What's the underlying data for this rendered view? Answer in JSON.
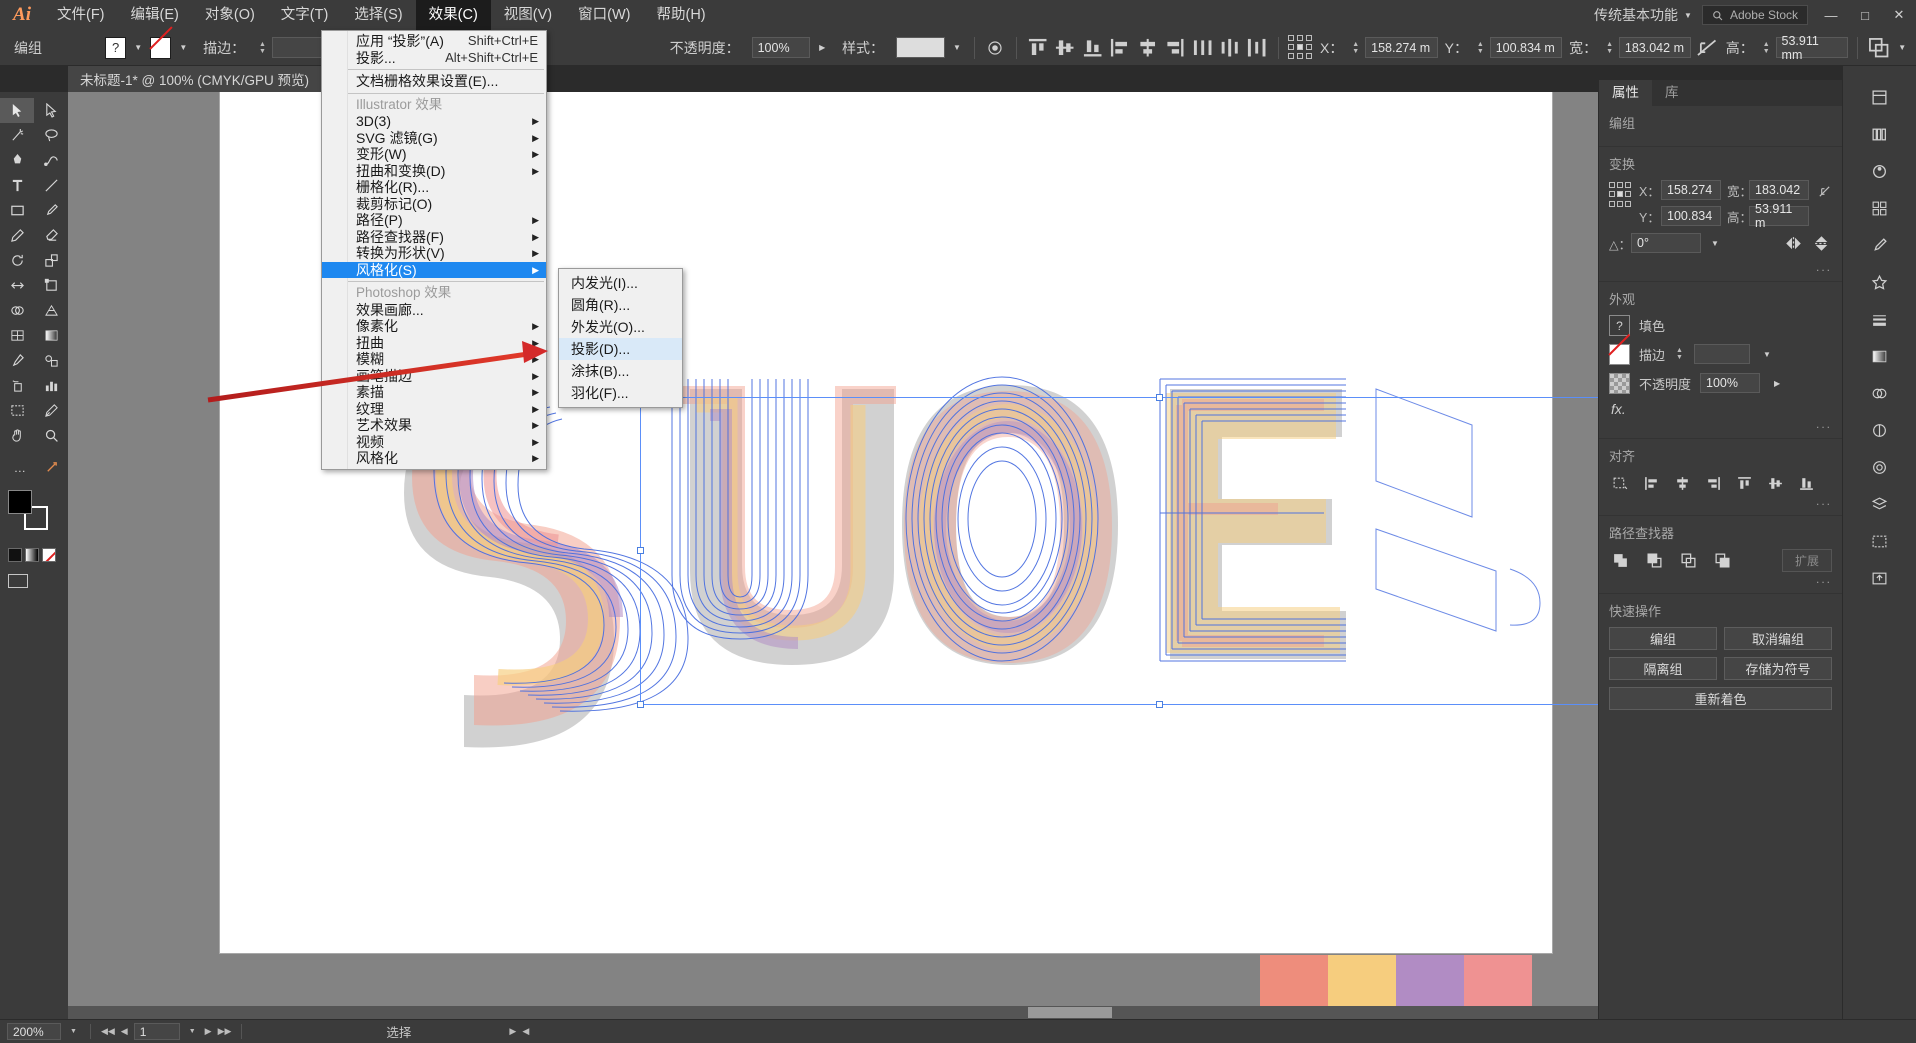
{
  "app": {
    "name": "Ai",
    "workspace": "传统基本功能",
    "stock_label": "Adobe Stock"
  },
  "menubar": {
    "items": [
      {
        "label": "文件(F)"
      },
      {
        "label": "编辑(E)"
      },
      {
        "label": "对象(O)"
      },
      {
        "label": "文字(T)"
      },
      {
        "label": "选择(S)"
      },
      {
        "label": "效果(C)"
      },
      {
        "label": "视图(V)"
      },
      {
        "label": "窗口(W)"
      },
      {
        "label": "帮助(H)"
      }
    ],
    "active_index": 5,
    "window_buttons": [
      "—",
      "□",
      "✕"
    ]
  },
  "controlbar": {
    "selection_label": "编组",
    "fill_label": "?",
    "stroke_label": "描边：",
    "stroke_weight": "",
    "opacity_label": "不透明度：",
    "opacity_value": "100%",
    "style_label": "样式：",
    "x_label": "X：",
    "x_value": "158.274 m",
    "y_label": "Y：",
    "y_value": "100.834 m",
    "w_label": "宽：",
    "w_value": "183.042 m",
    "h_label": "高：",
    "h_value": "53.911 mm"
  },
  "tabbar": {
    "doc_title": "未标题-1* @ 100% (CMYK/GPU 预览)",
    "close": "✕"
  },
  "dropdown": {
    "groups": [
      {
        "items": [
          {
            "label": "应用 “投影”(A)",
            "shortcut": "Shift+Ctrl+E",
            "arrow": false,
            "disabled": false
          },
          {
            "label": "投影...",
            "shortcut": "Alt+Shift+Ctrl+E",
            "arrow": false,
            "disabled": false
          }
        ]
      },
      {
        "items": [
          {
            "label": "文档栅格效果设置(E)...",
            "shortcut": "",
            "arrow": false,
            "disabled": false
          }
        ]
      },
      {
        "header": "Illustrator 效果",
        "items": [
          {
            "label": "3D(3)",
            "shortcut": "",
            "arrow": true
          },
          {
            "label": "SVG 滤镜(G)",
            "shortcut": "",
            "arrow": true
          },
          {
            "label": "变形(W)",
            "shortcut": "",
            "arrow": true
          },
          {
            "label": "扭曲和变换(D)",
            "shortcut": "",
            "arrow": true
          },
          {
            "label": "栅格化(R)...",
            "shortcut": "",
            "arrow": false
          },
          {
            "label": "裁剪标记(O)",
            "shortcut": "",
            "arrow": false
          },
          {
            "label": "路径(P)",
            "shortcut": "",
            "arrow": true
          },
          {
            "label": "路径查找器(F)",
            "shortcut": "",
            "arrow": true
          },
          {
            "label": "转换为形状(V)",
            "shortcut": "",
            "arrow": true
          },
          {
            "label": "风格化(S)",
            "shortcut": "",
            "arrow": true,
            "highlight": true
          }
        ]
      },
      {
        "header": "Photoshop 效果",
        "items": [
          {
            "label": "效果画廊...",
            "shortcut": "",
            "arrow": false
          },
          {
            "label": "像素化",
            "shortcut": "",
            "arrow": true
          },
          {
            "label": "扭曲",
            "shortcut": "",
            "arrow": true
          },
          {
            "label": "模糊",
            "shortcut": "",
            "arrow": true
          },
          {
            "label": "画笔描边",
            "shortcut": "",
            "arrow": true
          },
          {
            "label": "素描",
            "shortcut": "",
            "arrow": true
          },
          {
            "label": "纹理",
            "shortcut": "",
            "arrow": true
          },
          {
            "label": "艺术效果",
            "shortcut": "",
            "arrow": true
          },
          {
            "label": "视频",
            "shortcut": "",
            "arrow": true
          },
          {
            "label": "风格化",
            "shortcut": "",
            "arrow": true
          }
        ]
      }
    ]
  },
  "submenu": {
    "items": [
      {
        "label": "内发光(I)...",
        "highlight": false
      },
      {
        "label": "圆角(R)...",
        "highlight": false
      },
      {
        "label": "外发光(O)...",
        "highlight": false
      },
      {
        "label": "投影(D)...",
        "highlight": true
      },
      {
        "label": "涂抹(B)...",
        "highlight": false
      },
      {
        "label": "羽化(F)...",
        "highlight": false
      }
    ]
  },
  "properties": {
    "tabs": [
      {
        "label": "属性",
        "active": true
      },
      {
        "label": "库",
        "active": false
      }
    ],
    "object_label": "编组",
    "transform": {
      "title": "变换",
      "x_label": "X：",
      "x_value": "158.274",
      "y_label": "Y：",
      "y_value": "100.834",
      "w_label": "宽：",
      "w_value": "183.042",
      "h_label": "高：",
      "h_value": "53.911 m",
      "angle_label": "△：",
      "angle_value": "0°",
      "more": "..."
    },
    "appearance": {
      "title": "外观",
      "fill_label": "填色",
      "fill_swatch_text": "?",
      "stroke_label": "描边",
      "opacity_label": "不透明度",
      "opacity_value": "100%",
      "fx_label": "fx.",
      "more": "..."
    },
    "align": {
      "title": "对齐",
      "more": "..."
    },
    "pathfinder": {
      "title": "路径查找器",
      "more": "...",
      "expand_label": "扩展"
    },
    "quick": {
      "title": "快速操作",
      "buttons": [
        "编组",
        "取消编组",
        "隔离组",
        "存储为符号",
        "重新着色"
      ]
    }
  },
  "statusbar": {
    "zoom": "200%",
    "page": "1",
    "tool_label": "选择"
  },
  "artwork": {
    "text": "SUOE",
    "palette_colors": [
      "#ee8d7c",
      "#f6cd7e",
      "#b18cc4",
      "#ef9292"
    ],
    "shadow_color": "#c8c8c8",
    "outline_color": "#4a6fe0"
  },
  "colors": {
    "menu_highlight": "#1e88f0",
    "submenu_highlight": "#d9e9f8",
    "accent_blue": "#5b8ff9",
    "panel_bg": "#3b3b3b",
    "canvas_bg": "#838383",
    "annotation_red": "#d42a2a"
  }
}
